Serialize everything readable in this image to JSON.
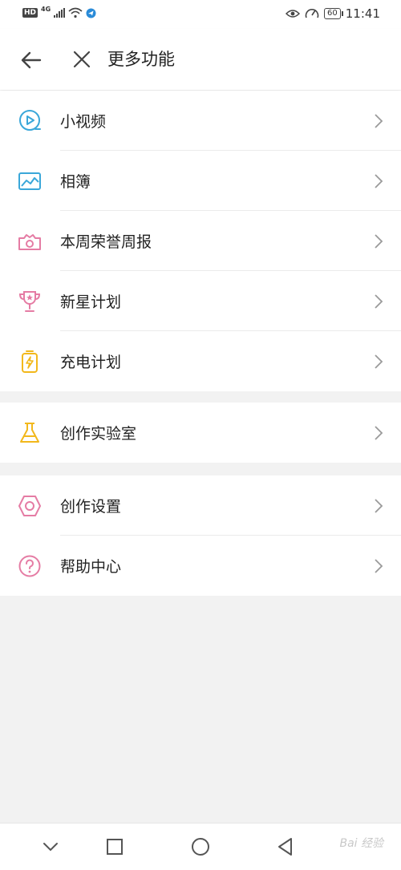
{
  "status_bar": {
    "hd_badge": "HD",
    "network": "4G",
    "battery": "60",
    "time": "11:41"
  },
  "header": {
    "title": "更多功能"
  },
  "groups": [
    {
      "items": [
        {
          "label": "小视频",
          "icon": "play-circle-icon",
          "color": "#3aa7d9"
        },
        {
          "label": "相簿",
          "icon": "image-icon",
          "color": "#3aa7d9"
        },
        {
          "label": "本周荣誉周报",
          "icon": "camera-crown-icon",
          "color": "#e57ca4"
        },
        {
          "label": "新星计划",
          "icon": "trophy-icon",
          "color": "#e57ca4"
        },
        {
          "label": "充电计划",
          "icon": "battery-bolt-icon",
          "color": "#f2b81c"
        }
      ]
    },
    {
      "items": [
        {
          "label": "创作实验室",
          "icon": "flask-icon",
          "color": "#f2b81c"
        }
      ]
    },
    {
      "items": [
        {
          "label": "创作设置",
          "icon": "hexagon-settings-icon",
          "color": "#e57ca4"
        },
        {
          "label": "帮助中心",
          "icon": "help-circle-icon",
          "color": "#e57ca4"
        }
      ]
    }
  ],
  "nav_bar": {
    "watermark": "Bai 经验"
  }
}
